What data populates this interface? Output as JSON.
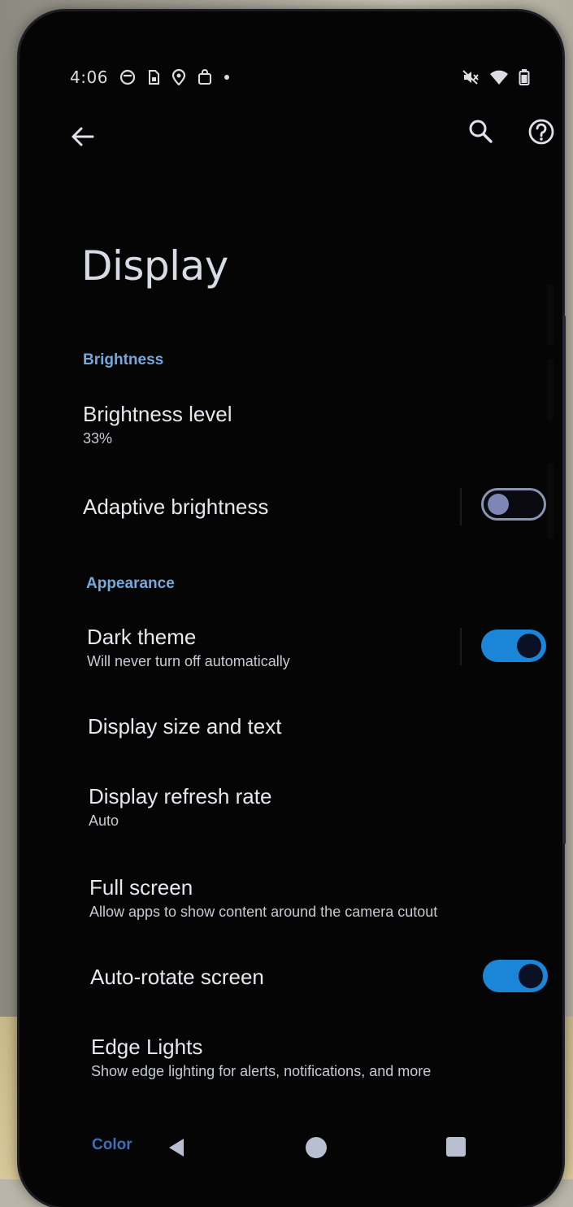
{
  "status_bar": {
    "time": "4:06",
    "left_icons": [
      "media-icon",
      "sim-icon",
      "location-pin-icon",
      "bag-icon",
      "dot-icon"
    ],
    "right_icons": [
      "mute-icon",
      "wifi-icon",
      "battery-icon"
    ]
  },
  "app_bar": {
    "back_icon": "arrow-left-icon",
    "search_icon": "search-icon",
    "help_icon": "help-icon"
  },
  "page": {
    "title": "Display"
  },
  "sections": {
    "brightness": "Brightness",
    "appearance": "Appearance",
    "color": "Color"
  },
  "items": {
    "brightness_level": {
      "title": "Brightness level",
      "summary": "33%"
    },
    "adaptive_brightness": {
      "title": "Adaptive brightness",
      "toggle": false
    },
    "dark_theme": {
      "title": "Dark theme",
      "summary": "Will never turn off automatically",
      "toggle": true
    },
    "display_size": {
      "title": "Display size and text"
    },
    "refresh_rate": {
      "title": "Display refresh rate",
      "summary": "Auto"
    },
    "full_screen": {
      "title": "Full screen",
      "summary": "Allow apps to show content around the camera cutout"
    },
    "auto_rotate": {
      "title": "Auto-rotate screen",
      "toggle": true
    },
    "edge_lights": {
      "title": "Edge Lights",
      "summary": "Show edge lighting for alerts, notifications, and more"
    }
  },
  "colors": {
    "accent": "#74a9dd",
    "toggle_on": "#1b86d8",
    "background": "#050506"
  },
  "nav_bar": {
    "back": "nav-back-icon",
    "home": "nav-home-icon",
    "recents": "nav-recents-icon"
  }
}
